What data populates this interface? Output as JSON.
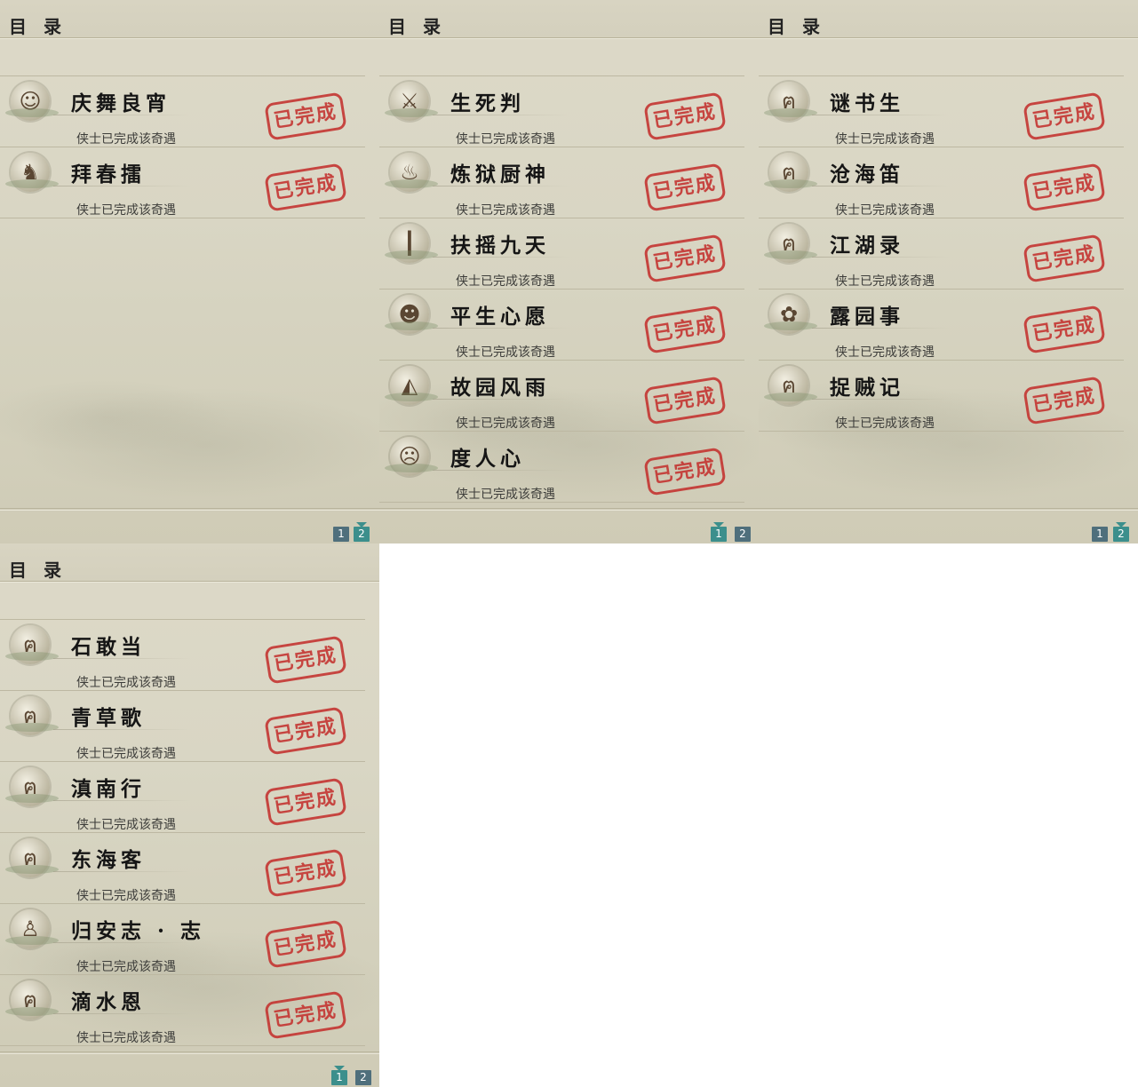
{
  "panels": [
    {
      "title": "目 录",
      "items": [
        {
          "name": "庆舞良宵",
          "status": "侠士已完成该奇遇",
          "stamp": "已完成",
          "icon": "lion-dance-icon"
        },
        {
          "name": "拜春擂",
          "status": "侠士已完成该奇遇",
          "stamp": "已完成",
          "icon": "kangaroo-icon"
        }
      ],
      "pages": [
        "1",
        "2"
      ],
      "active_page": "2"
    },
    {
      "title": "目 录",
      "items": [
        {
          "name": "生死判",
          "status": "侠士已完成该奇遇",
          "stamp": "已完成",
          "icon": "broken-sword-icon"
        },
        {
          "name": "炼狱厨神",
          "status": "侠士已完成该奇遇",
          "stamp": "已完成",
          "icon": "cooking-pot-icon"
        },
        {
          "name": "扶摇九天",
          "status": "侠士已完成该奇遇",
          "stamp": "已完成",
          "icon": "wooden-post-icon"
        },
        {
          "name": "平生心愿",
          "status": "侠士已完成该奇遇",
          "stamp": "已完成",
          "icon": "official-figure-icon"
        },
        {
          "name": "故园风雨",
          "status": "侠士已完成该奇遇",
          "stamp": "已完成",
          "icon": "fan-icon"
        },
        {
          "name": "度人心",
          "status": "侠士已完成该奇遇",
          "stamp": "已完成",
          "icon": "mask-icon"
        }
      ],
      "pages": [
        "1",
        "2"
      ],
      "active_page": "1"
    },
    {
      "title": "目 录",
      "items": [
        {
          "name": "谜书生",
          "status": "侠士已完成该奇遇",
          "stamp": "已完成",
          "icon": "cat-icon"
        },
        {
          "name": "沧海笛",
          "status": "侠士已完成该奇遇",
          "stamp": "已完成",
          "icon": "cat-icon"
        },
        {
          "name": "江湖录",
          "status": "侠士已完成该奇遇",
          "stamp": "已完成",
          "icon": "cat-icon"
        },
        {
          "name": "露园事",
          "status": "侠士已完成该奇遇",
          "stamp": "已完成",
          "icon": "fairy-pet-icon"
        },
        {
          "name": "捉贼记",
          "status": "侠士已完成该奇遇",
          "stamp": "已完成",
          "icon": "cat-icon"
        }
      ],
      "pages": [
        "1",
        "2"
      ],
      "active_page": "2"
    },
    {
      "title": "目 录",
      "items": [
        {
          "name": "石敢当",
          "status": "侠士已完成该奇遇",
          "stamp": "已完成",
          "icon": "cat-icon"
        },
        {
          "name": "青草歌",
          "status": "侠士已完成该奇遇",
          "stamp": "已完成",
          "icon": "cat-icon"
        },
        {
          "name": "滇南行",
          "status": "侠士已完成该奇遇",
          "stamp": "已完成",
          "icon": "cat-icon"
        },
        {
          "name": "东海客",
          "status": "侠士已完成该奇遇",
          "stamp": "已完成",
          "icon": "cat-icon"
        },
        {
          "name": "归安志 · 志",
          "status": "侠士已完成该奇遇",
          "stamp": "已完成",
          "icon": "buddha-statue-icon"
        },
        {
          "name": "滴水恩",
          "status": "侠士已完成该奇遇",
          "stamp": "已完成",
          "icon": "cat-icon"
        }
      ],
      "pages": [
        "1",
        "2"
      ],
      "active_page": "1"
    }
  ]
}
